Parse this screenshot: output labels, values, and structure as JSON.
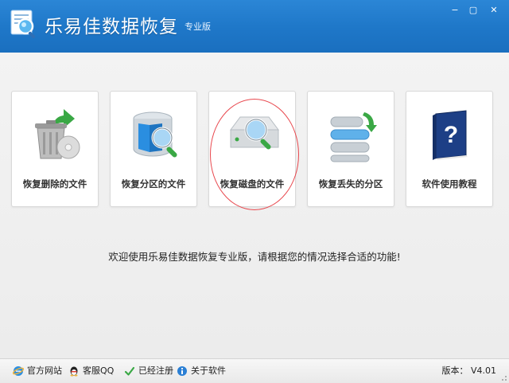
{
  "app": {
    "title": "乐易佳数据恢复",
    "edition": "专业版"
  },
  "window_controls": {
    "minimize": "−",
    "maximize": "▢",
    "close": "✕"
  },
  "cards": [
    {
      "label": "恢复删除的文件",
      "icon": "recycle-bin-icon"
    },
    {
      "label": "恢复分区的文件",
      "icon": "partition-search-icon"
    },
    {
      "label": "恢复磁盘的文件",
      "icon": "disk-search-icon"
    },
    {
      "label": "恢复丢失的分区",
      "icon": "lost-partition-icon"
    },
    {
      "label": "软件使用教程",
      "icon": "help-book-icon"
    }
  ],
  "welcome_text": "欢迎使用乐易佳数据恢复专业版，请根据您的情况选择合适的功能!",
  "statusbar": {
    "items": [
      {
        "label": "官方网站",
        "icon": "ie-icon"
      },
      {
        "label": "客服QQ",
        "icon": "qq-icon"
      },
      {
        "label": "已经注册",
        "icon": "checkmark-icon"
      },
      {
        "label": "关于软件",
        "icon": "info-icon"
      }
    ],
    "version": "版本： V4.01"
  },
  "colors": {
    "titlebar": "#1f78c9",
    "highlight_ring": "#e8474d"
  }
}
